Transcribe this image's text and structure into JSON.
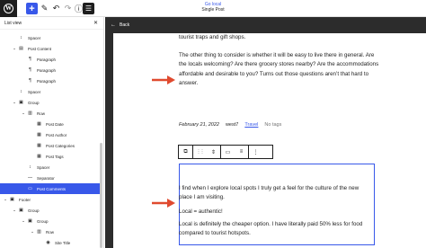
{
  "toolbar": {
    "logo_letter": "W",
    "add_icon": "plus-icon",
    "edit_icon": "pencil-icon",
    "undo_icon": "undo-icon",
    "redo_icon": "redo-icon",
    "info_icon": "info-icon",
    "listview_icon": "list-view-icon",
    "doc_link": "Go local",
    "doc_title": "Single Post"
  },
  "listview": {
    "title": "List view",
    "close": "✕",
    "items": [
      {
        "label": "Spacer",
        "chev": "",
        "icon": "spacer-icon",
        "glyph": "↕"
      },
      {
        "label": "Post Content",
        "chev": "⌄",
        "icon": "post-content-icon",
        "glyph": "▤"
      },
      {
        "label": "Paragraph",
        "chev": "",
        "icon": "paragraph-icon",
        "glyph": "¶"
      },
      {
        "label": "Paragraph",
        "chev": "",
        "icon": "paragraph-icon",
        "glyph": "¶"
      },
      {
        "label": "Paragraph",
        "chev": "",
        "icon": "paragraph-icon",
        "glyph": "¶"
      },
      {
        "label": "Spacer",
        "chev": "",
        "icon": "spacer-icon",
        "glyph": "↕"
      },
      {
        "label": "Group",
        "chev": "⌄",
        "icon": "group-icon",
        "glyph": "▣"
      },
      {
        "label": "Row",
        "chev": "⌄",
        "icon": "row-icon",
        "glyph": "▥"
      },
      {
        "label": "Post Date",
        "chev": "",
        "icon": "post-date-icon",
        "glyph": "▦"
      },
      {
        "label": "Post Author",
        "chev": "",
        "icon": "post-author-icon",
        "glyph": "▦"
      },
      {
        "label": "Post Categories",
        "chev": "",
        "icon": "post-categories-icon",
        "glyph": "▦"
      },
      {
        "label": "Post Tags",
        "chev": "",
        "icon": "post-tags-icon",
        "glyph": "▦"
      },
      {
        "label": "Spacer",
        "chev": "",
        "icon": "spacer-icon",
        "glyph": "↕"
      },
      {
        "label": "Separator",
        "chev": "",
        "icon": "separator-icon",
        "glyph": "—"
      },
      {
        "label": "Post Comments",
        "chev": "",
        "icon": "post-comments-icon",
        "glyph": "▭"
      },
      {
        "label": "Footer",
        "chev": "⌄",
        "icon": "footer-icon",
        "glyph": "▣"
      },
      {
        "label": "Group",
        "chev": "⌄",
        "icon": "group-icon",
        "glyph": "▣"
      },
      {
        "label": "Group",
        "chev": "⌄",
        "icon": "group-icon",
        "glyph": "▣"
      },
      {
        "label": "Row",
        "chev": "⌄",
        "icon": "row-icon",
        "glyph": "▥"
      },
      {
        "label": "Site Title",
        "chev": "",
        "icon": "site-title-icon",
        "glyph": "◉"
      }
    ]
  },
  "editor": {
    "back_label": "Back",
    "p1": "tourist traps and gift shops.",
    "p2": "The other thing to consider is whether it will be easy to live there in general. Are the locals welcoming? Are there grocery stores nearby? Are the accommodations affordable and desirable to you? Turns out those questions aren’t that hard to answer.",
    "meta_date": "February 21, 2022",
    "meta_author": "west7",
    "meta_category": "Travel",
    "meta_tags": "No tags",
    "comment_p1": "I find when I explore local spots I truly get a feel for the culture of the new place I am visiting.",
    "comment_p2": "Local = authentic!",
    "comment_p3": "Local is definitely the cheaper option. I have literally paid 50% less for food compared to tourist hotspots."
  },
  "block_toolbar": {
    "icons": [
      "post-comments-icon",
      "drag-handle-icon",
      "move-arrows-icon",
      "align-icon",
      "justify-icon",
      "more-options-icon"
    ]
  },
  "colors": {
    "accent": "#3858e9",
    "arrow": "#e04a2f",
    "frame": "#2c2c2c"
  }
}
